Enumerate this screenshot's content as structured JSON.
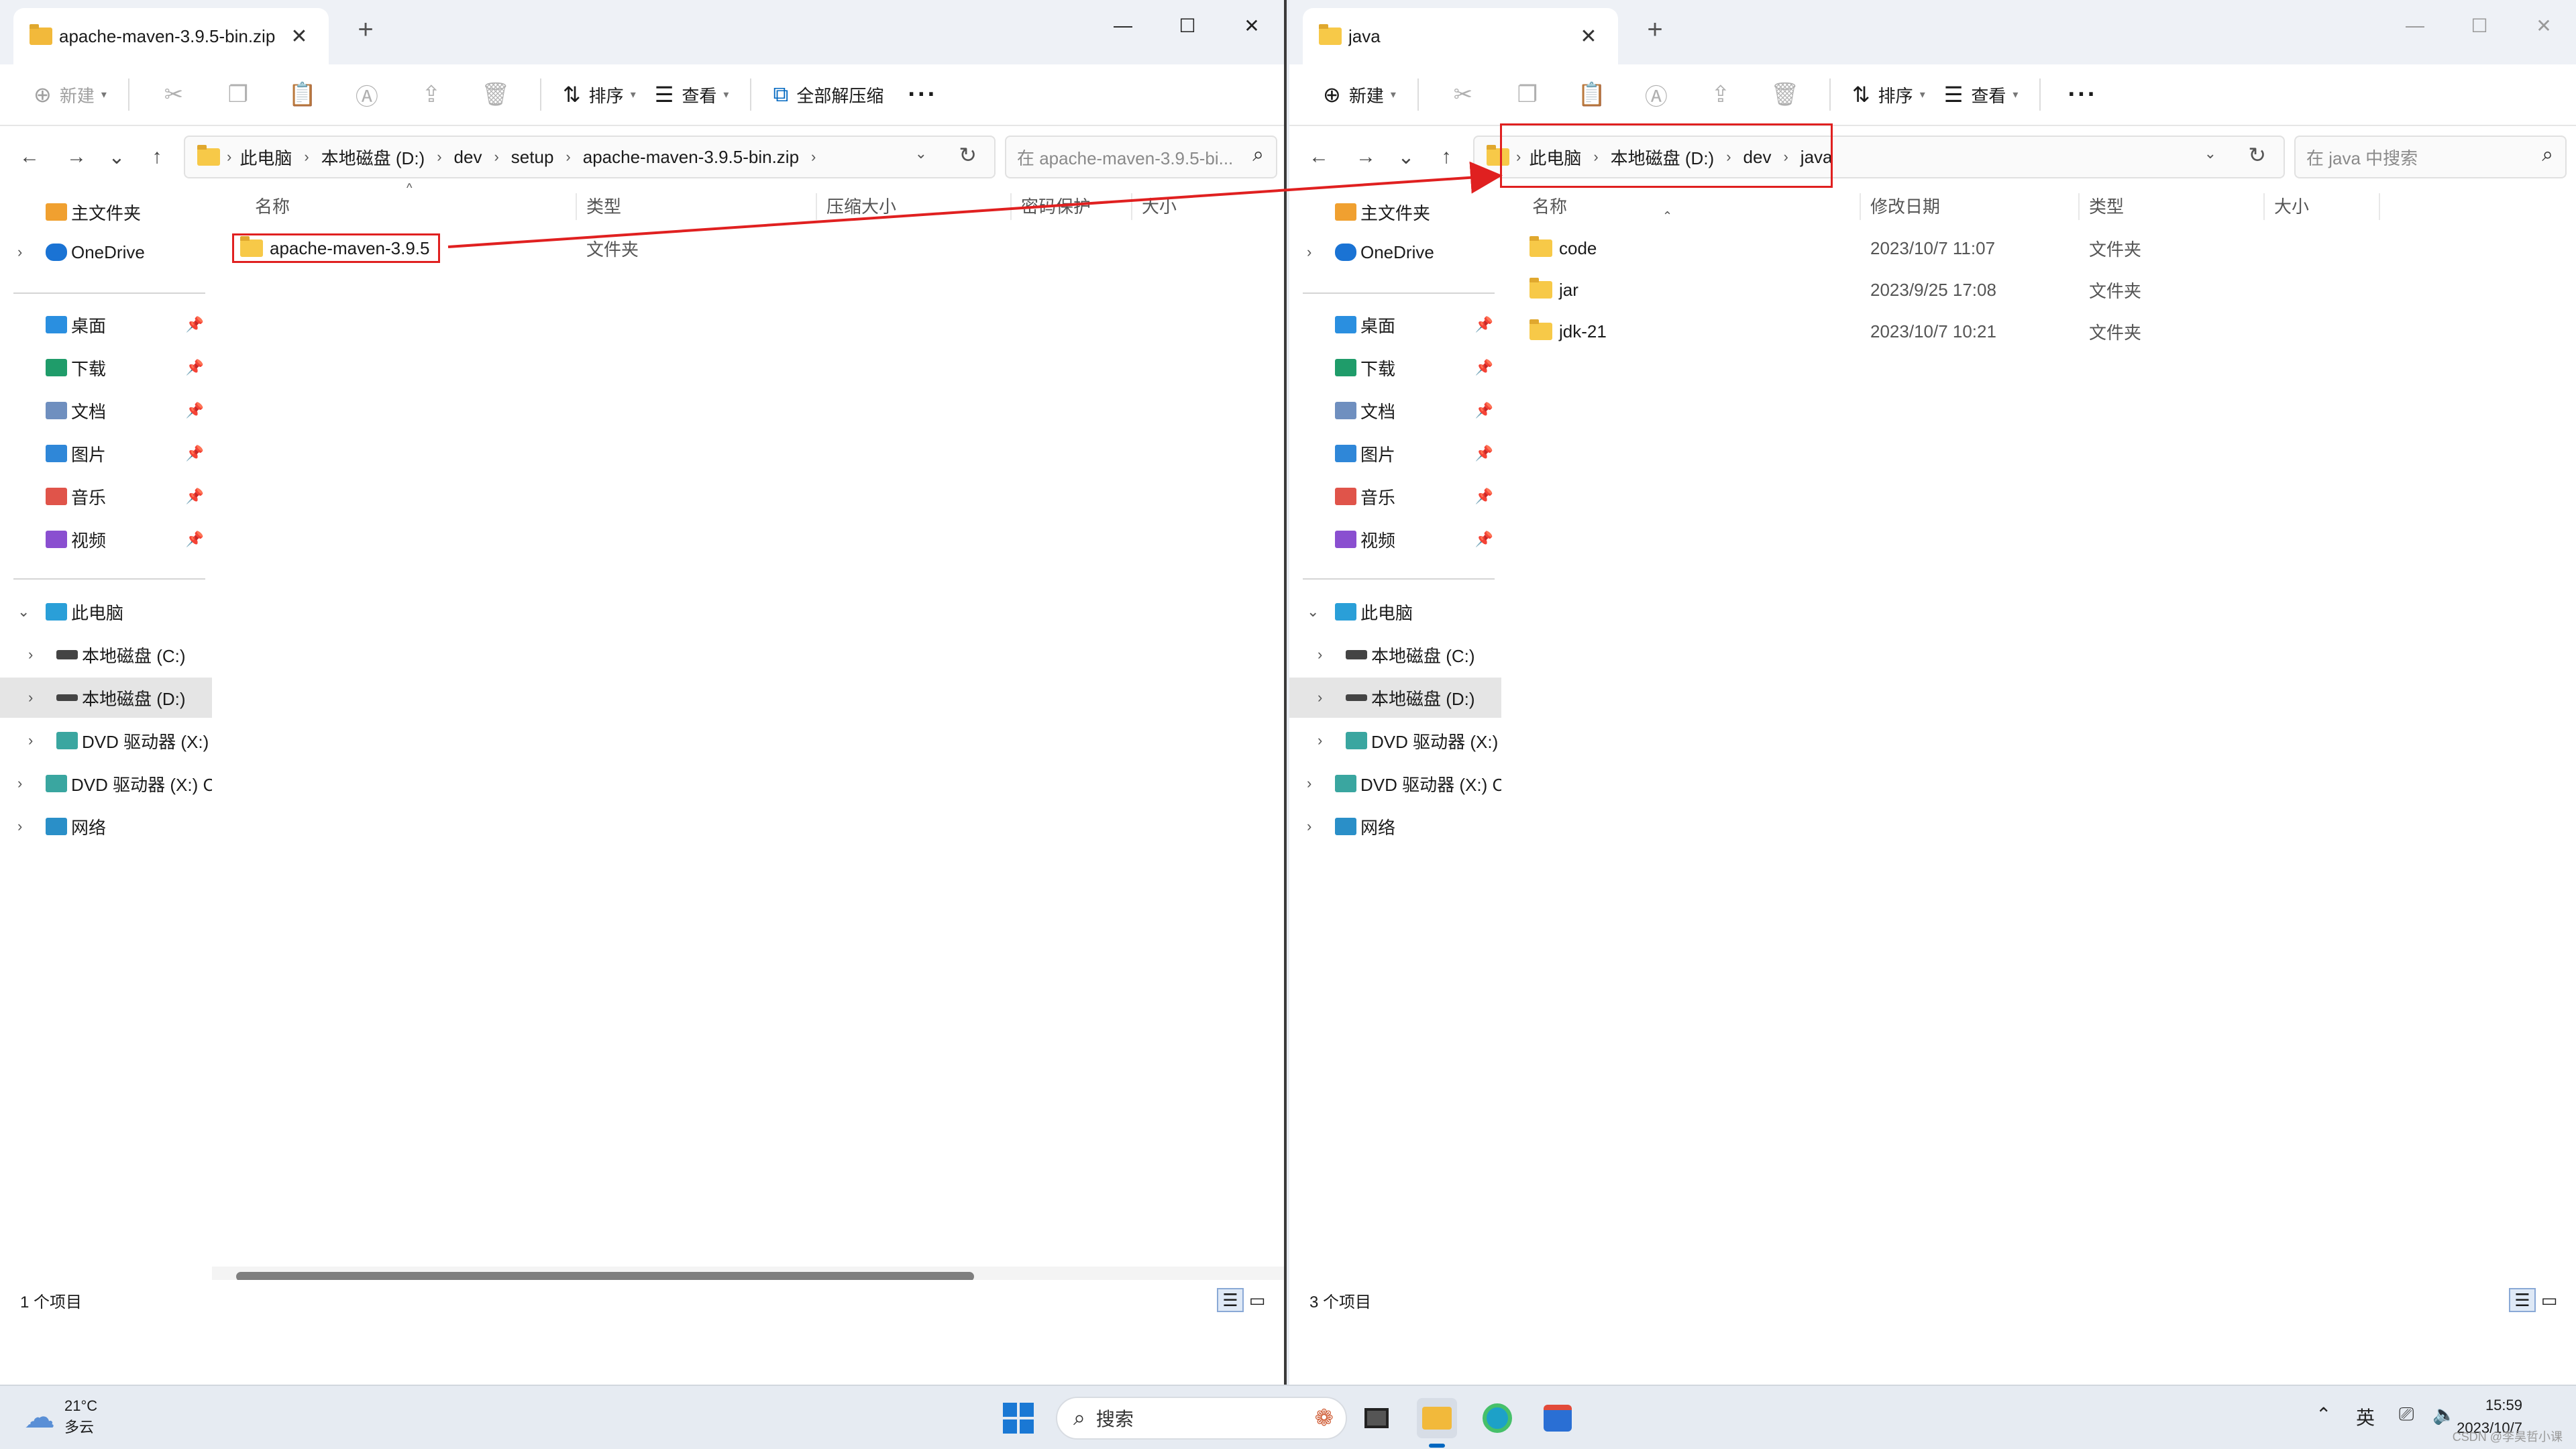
{
  "left_window": {
    "tab_title": "apache-maven-3.9.5-bin.zip",
    "toolbar": {
      "new": "新建",
      "sort": "排序",
      "view": "查看",
      "extract_all": "全部解压缩",
      "more": "···"
    },
    "breadcrumbs": [
      "此电脑",
      "本地磁盘 (D:)",
      "dev",
      "setup",
      "apache-maven-3.9.5-bin.zip"
    ],
    "search_placeholder": "在 apache-maven-3.9.5-bi...",
    "columns": [
      "名称",
      "类型",
      "压缩大小",
      "密码保护",
      "大小"
    ],
    "rows": [
      {
        "name": "apache-maven-3.9.5",
        "type": "文件夹"
      }
    ],
    "status": "1 个项目"
  },
  "right_window": {
    "tab_title": "java",
    "toolbar": {
      "new": "新建",
      "sort": "排序",
      "view": "查看",
      "more": "···"
    },
    "breadcrumbs": [
      "此电脑",
      "本地磁盘 (D:)",
      "dev",
      "java"
    ],
    "search_placeholder": "在 java 中搜索",
    "columns": [
      "名称",
      "修改日期",
      "类型",
      "大小"
    ],
    "rows": [
      {
        "name": "code",
        "date": "2023/10/7 11:07",
        "type": "文件夹"
      },
      {
        "name": "jar",
        "date": "2023/9/25 17:08",
        "type": "文件夹"
      },
      {
        "name": "jdk-21",
        "date": "2023/10/7 10:21",
        "type": "文件夹"
      }
    ],
    "status": "3 个项目"
  },
  "nav": {
    "home": "主文件夹",
    "onedrive": "OneDrive",
    "desktop": "桌面",
    "downloads": "下载",
    "documents": "文档",
    "pictures": "图片",
    "music": "音乐",
    "videos": "视频",
    "this_pc": "此电脑",
    "drive_c": "本地磁盘 (C:)",
    "drive_d": "本地磁盘 (D:)",
    "dvd_1": "DVD 驱动器 (X:) C",
    "dvd_2": "DVD 驱动器 (X:) CC",
    "network": "网络"
  },
  "taskbar": {
    "temp": "21°C",
    "weather": "多云",
    "search": "搜索",
    "ime": "英",
    "time": "15:59",
    "date": "2023/10/7",
    "watermark": "CSDN @李昊哲小课"
  },
  "colors": {
    "highlight_box": "#e02020",
    "folder": "#f7c948",
    "accent": "#0067c0"
  }
}
